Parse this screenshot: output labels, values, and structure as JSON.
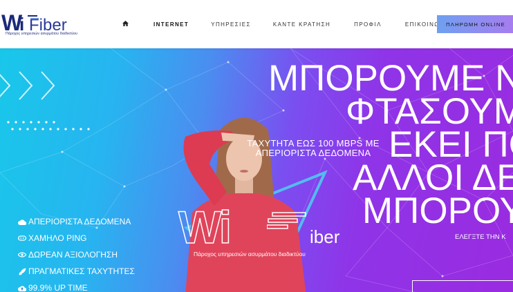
{
  "brand": {
    "wordmark_w": "W",
    "wordmark_i": "i",
    "wordmark_rest": "Fiber",
    "tagline": "Πάροχος υπηρεσιών ασυρμάτου διαδικτύου",
    "accent": "#1c2a7a"
  },
  "nav": {
    "home_icon": "home-icon",
    "items": [
      {
        "label": "INTERNET",
        "bold": true
      },
      {
        "label": "ΥΠΗΡΕΣΙΕΣ",
        "bold": false
      },
      {
        "label": "ΚΑΝΤΕ ΚΡΑΤΗΣΗ",
        "bold": false
      },
      {
        "label": "ΠΡΟΦΙΛ",
        "bold": false
      },
      {
        "label": "ΕΠΙΚΟΙΝΩΝΙΑ",
        "bold": false
      }
    ],
    "pay_button": "ΠΛΗΡΩΜΗ ONLINE"
  },
  "hero": {
    "headline": [
      "ΜΠΟΡΟΥΜΕ Ν",
      "ΦΤΑΣΟΥΜ",
      "ΕΚΕΙ ΠΟ",
      "ΑΛΛΟΙ ΔΕ",
      "ΜΠΟΡΟΥ"
    ],
    "speed_line1": "ΤΑΧΥΤΗΤΑ ΕΩΣ 100 MBPS ΜΕ",
    "speed_line2": "ΑΠΕΡΙΟΡΙΣΤΑ ΔΕΔΟΜΕΝΑ",
    "check_text": "ΕΛΕΓΞΤΕ ΤΗΝ Κ",
    "logo_w": "Wi",
    "logo_rest": "iber",
    "logo_sub": "Πάροχος υπηρεσιών ασυρμάτου διαδικτύου",
    "features": [
      {
        "icon": "cloud-icon",
        "label": "ΑΠΕΡΙΟΡΙΣΤΑ ΔΕΔΟΜΕΝΑ"
      },
      {
        "icon": "gamepad-icon",
        "label": "ΧΑΜΗΛΟ PING"
      },
      {
        "icon": "eye-icon",
        "label": "ΔΩΡΕΑΝ ΑΞΙΟΛΟΓΗΣΗ"
      },
      {
        "icon": "rocket-icon",
        "label": "ΠΡΑΓΜΑΤΙΚΕΣ ΤΑΧΥΤΗΤΕΣ"
      },
      {
        "icon": "cloud-upload-icon",
        "label": "99.9% UP TIME"
      }
    ]
  }
}
